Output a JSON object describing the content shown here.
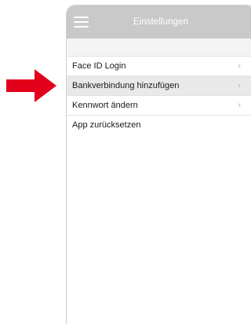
{
  "navbar": {
    "title": "Einstellungen",
    "menu_icon": "hamburger-menu-icon"
  },
  "settings": {
    "items": [
      {
        "label": "Face ID Login",
        "chevron": "›"
      },
      {
        "label": "Bankverbindung hinzufügen",
        "chevron": "›",
        "highlighted": true
      },
      {
        "label": "Kennwort ändern",
        "chevron": "›"
      },
      {
        "label": "App zurücksetzen"
      }
    ]
  },
  "pointer": {
    "icon": "right-arrow-icon",
    "color": "#e3001b"
  },
  "colors": {
    "navbar_bg": "#c9c9c9",
    "highlight_bg": "#e9e9e9"
  }
}
